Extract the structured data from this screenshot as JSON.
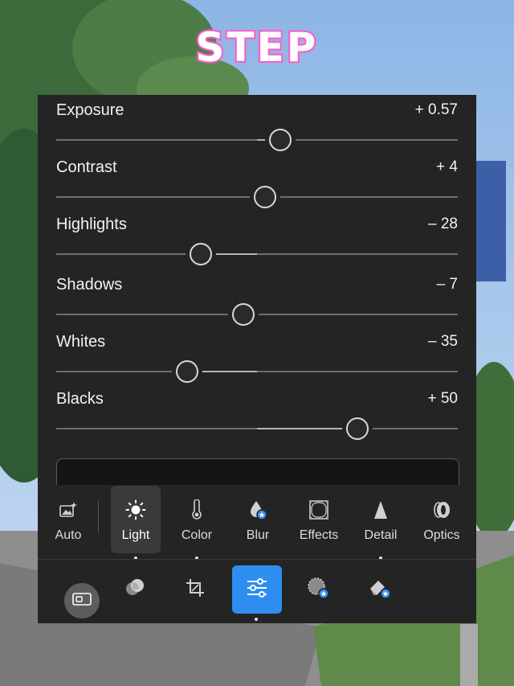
{
  "overlay": {
    "title": "STEP"
  },
  "sliders": [
    {
      "label": "Exposure",
      "value": "+ 0.57",
      "amount": 0.57,
      "min": -5,
      "max": 5
    },
    {
      "label": "Contrast",
      "value": "+ 4",
      "amount": 4,
      "min": -100,
      "max": 100
    },
    {
      "label": "Highlights",
      "value": "– 28",
      "amount": -28,
      "min": -100,
      "max": 100
    },
    {
      "label": "Shadows",
      "value": "– 7",
      "amount": -7,
      "min": -100,
      "max": 100
    },
    {
      "label": "Whites",
      "value": "– 35",
      "amount": -35,
      "min": -100,
      "max": 100
    },
    {
      "label": "Blacks",
      "value": "+ 50",
      "amount": 50,
      "min": -100,
      "max": 100
    }
  ],
  "tools": [
    {
      "label": "Auto",
      "icon": "auto-image-icon"
    },
    {
      "label": "Light",
      "icon": "sun-icon",
      "active": true
    },
    {
      "label": "Color",
      "icon": "thermometer-icon"
    },
    {
      "label": "Blur",
      "icon": "drop-premium-icon"
    },
    {
      "label": "Effects",
      "icon": "vignette-square-icon"
    },
    {
      "label": "Detail",
      "icon": "triangle-icon"
    },
    {
      "label": "Optics",
      "icon": "lens-icon"
    }
  ],
  "bottom_tabs": [
    {
      "name": "aspect-ratio",
      "icon": "aspect-ratio-icon"
    },
    {
      "name": "masking",
      "icon": "masking-icon"
    },
    {
      "name": "crop",
      "icon": "crop-icon"
    },
    {
      "name": "edit",
      "icon": "sliders-icon",
      "active": true
    },
    {
      "name": "presets",
      "icon": "presets-premium-icon"
    },
    {
      "name": "remove",
      "icon": "eraser-premium-icon"
    }
  ],
  "colors": {
    "panel": "#242424",
    "accent": "#2d8ef0",
    "title_stroke": "#f55bc6"
  }
}
